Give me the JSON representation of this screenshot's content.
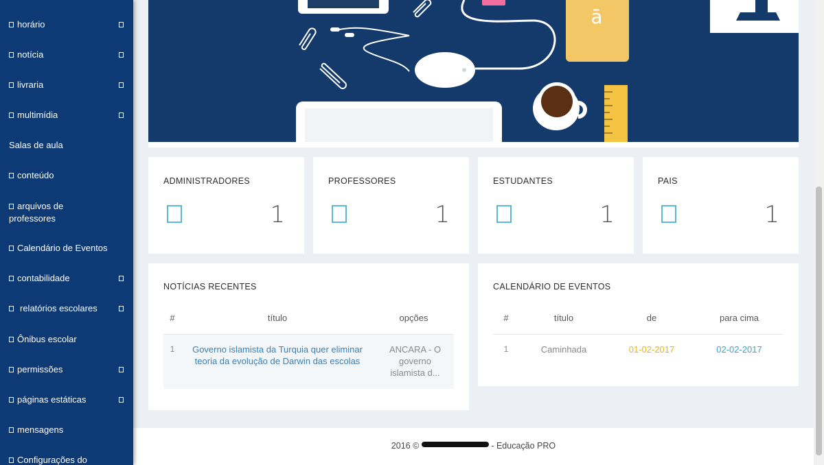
{
  "sidebar": {
    "items": [
      {
        "label": "horário",
        "has_arrow": true
      },
      {
        "label": "notícia",
        "has_arrow": true
      },
      {
        "label": "livraria",
        "has_arrow": true
      },
      {
        "label": "multimídia",
        "has_arrow": true
      },
      {
        "label": "Salas de aula",
        "has_arrow": false
      },
      {
        "label": "conteúdo",
        "has_arrow": false
      },
      {
        "label": "arquivos de professores",
        "has_arrow": false
      },
      {
        "label": "Calendário de Eventos",
        "has_arrow": false
      },
      {
        "label": "contabilidade",
        "has_arrow": true
      },
      {
        "label": "relatórios escolares",
        "has_arrow": true
      },
      {
        "label": "Ônibus escolar",
        "has_arrow": false
      },
      {
        "label": "permissões",
        "has_arrow": true
      },
      {
        "label": "páginas estáticas",
        "has_arrow": true
      },
      {
        "label": "mensagens",
        "has_arrow": false
      },
      {
        "label": "Configurações do",
        "has_arrow": false
      }
    ]
  },
  "banner": {
    "letter": "ā"
  },
  "stats": [
    {
      "label": "ADMINISTRADORES",
      "value": "1"
    },
    {
      "label": "PROFESSORES",
      "value": "1"
    },
    {
      "label": "ESTUDANTES",
      "value": "1"
    },
    {
      "label": "PAIS",
      "value": "1"
    }
  ],
  "news": {
    "title": "NOTÍCIAS RECENTES",
    "columns": [
      "#",
      "título",
      "opções"
    ],
    "rows": [
      {
        "num": "1",
        "title": "Governo islamista da Turquia quer eliminar teoria da evolução de Darwin das escolas",
        "options": "ANCARA - O governo islamista d..."
      }
    ]
  },
  "events": {
    "title": "CALENDÁRIO DE EVENTOS",
    "columns": [
      "#",
      "título",
      "de",
      "para cima"
    ],
    "rows": [
      {
        "num": "1",
        "title": "Caminhada",
        "from": "01-02-2017",
        "to": "02-02-2017"
      }
    ]
  },
  "footer": {
    "prefix": "2016 ©",
    "suffix": "- Educação PRO"
  },
  "colors": {
    "sidebar": "#0d3a74",
    "accent_link": "#3a7fb5",
    "date_from": "#e8b514",
    "date_to": "#3aa2c7",
    "icon": "#5bb8d6"
  }
}
